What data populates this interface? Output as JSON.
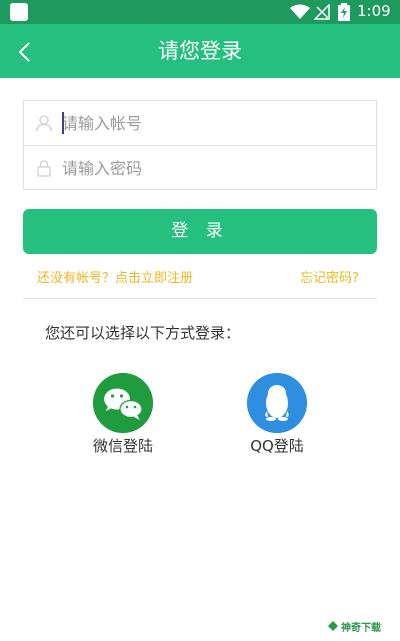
{
  "status_bar": {
    "time": "1:09",
    "icons": [
      "app-notification-icon",
      "wifi-icon",
      "no-signal-icon",
      "battery-charging-icon"
    ]
  },
  "header": {
    "title": "请您登录",
    "back_icon": "chevron-left-icon"
  },
  "form": {
    "account": {
      "placeholder": "请输入帐号",
      "value": "",
      "icon": "user-icon"
    },
    "password": {
      "placeholder": "请输入密码",
      "value": "",
      "icon": "lock-icon"
    },
    "login_label": "登 录"
  },
  "links": {
    "register": "还没有帐号？点击立即注册",
    "forgot": "忘记密码?"
  },
  "alternate": {
    "prompt": "您还可以选择以下方式登录：",
    "options": [
      {
        "label": "微信登陆",
        "icon": "wechat-icon"
      },
      {
        "label": "QQ登陆",
        "icon": "qq-penguin-icon"
      }
    ]
  },
  "watermark": {
    "text": "神奇下载"
  },
  "colors": {
    "status_bar": "#1f9a5e",
    "primary": "#25c07f",
    "link": "#f0b521",
    "wechat": "#1e9c3e",
    "qq": "#2e8fe0"
  }
}
